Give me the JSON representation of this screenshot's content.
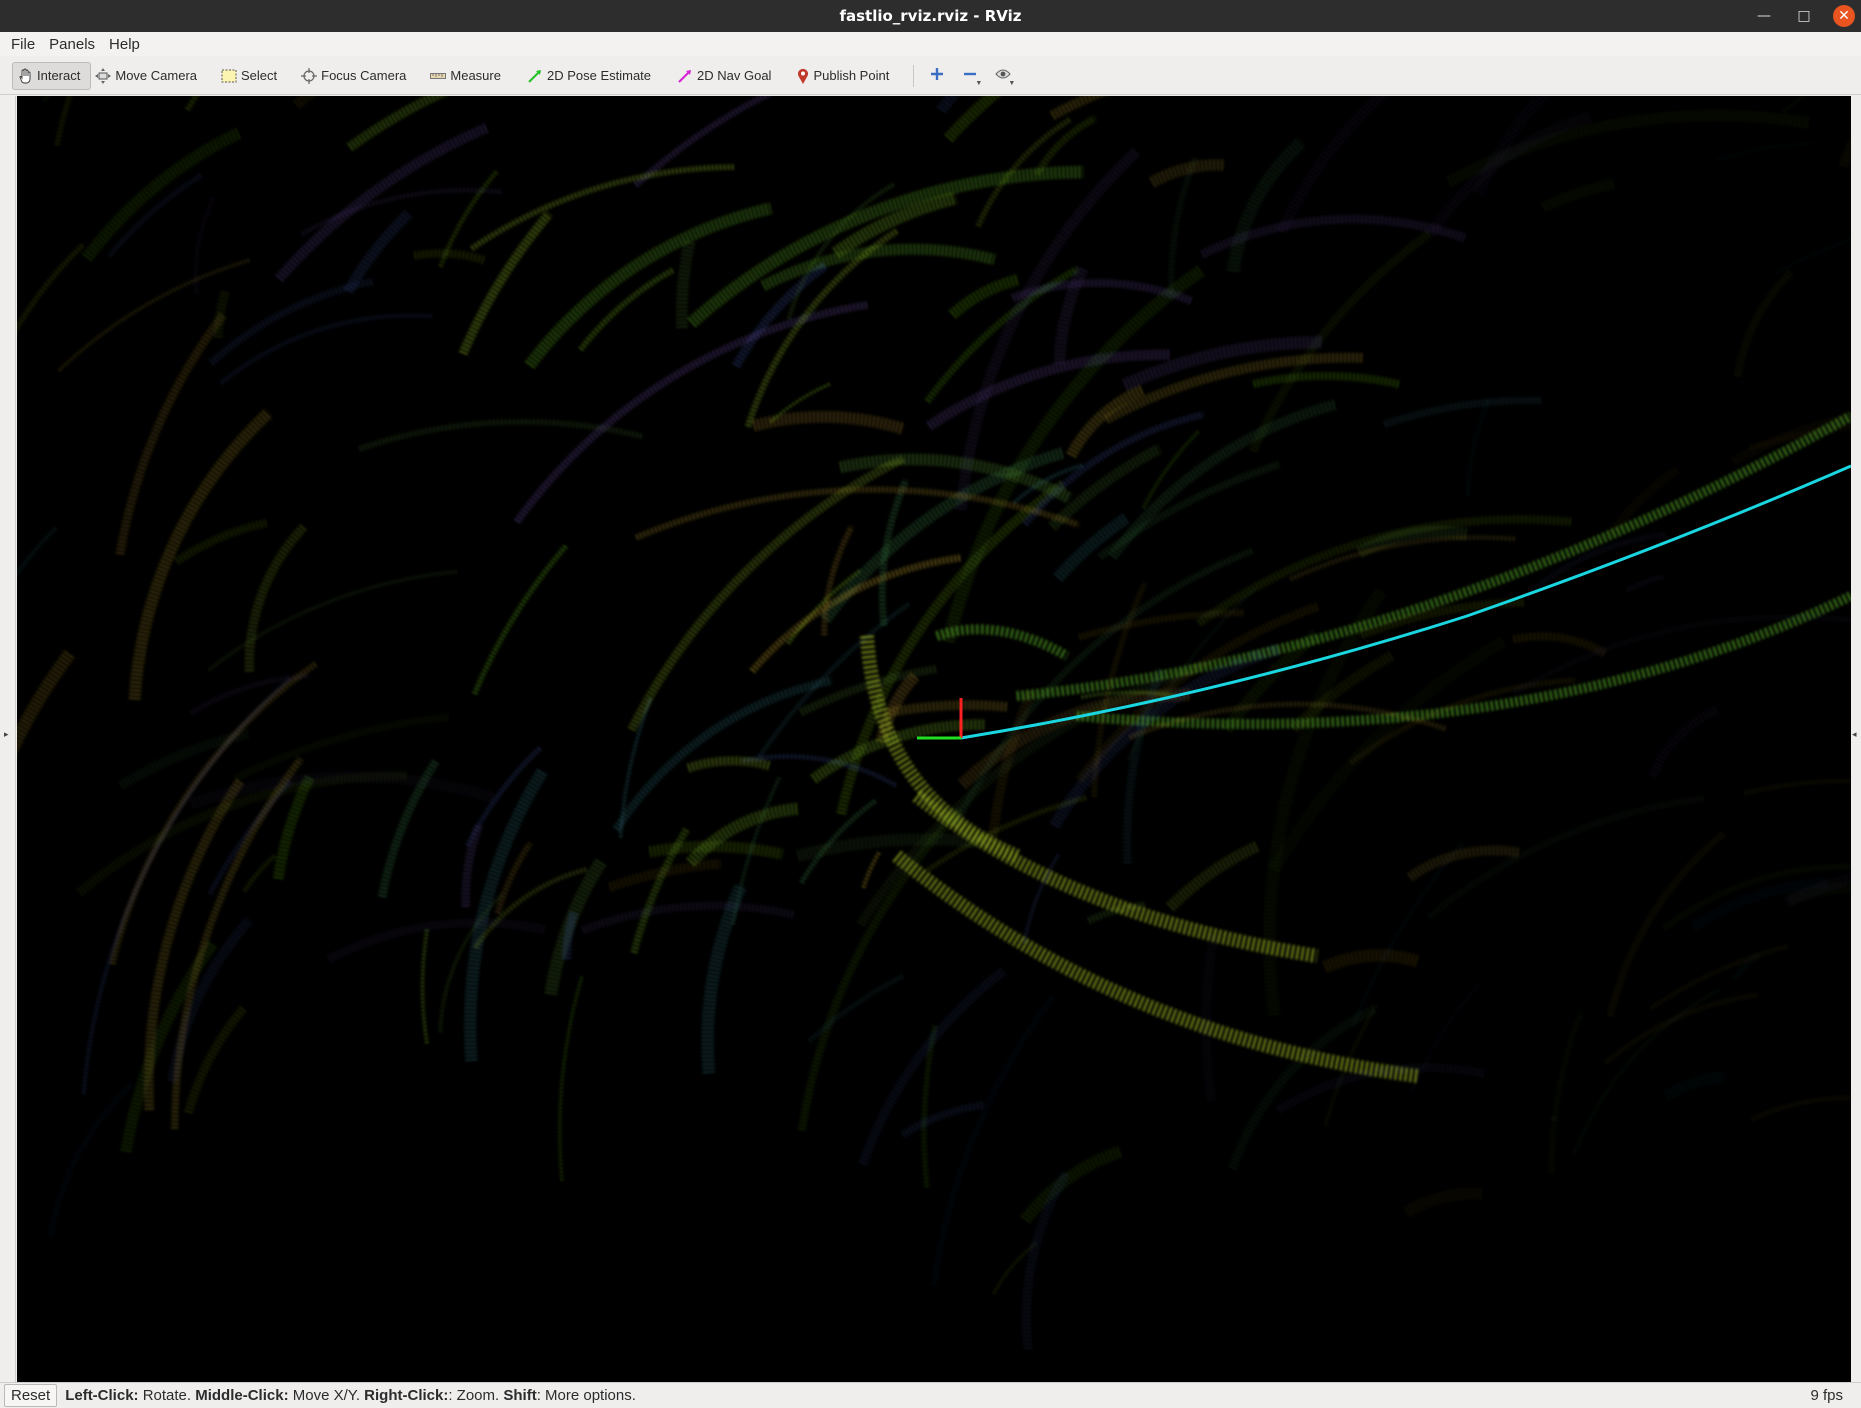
{
  "window": {
    "title": "fastlio_rviz.rviz - RViz",
    "controls": [
      "minimize-icon",
      "maximize-icon",
      "close-icon"
    ]
  },
  "menubar": {
    "items": [
      {
        "label": "File"
      },
      {
        "label": "Panels"
      },
      {
        "label": "Help"
      }
    ]
  },
  "toolbar": {
    "tools": [
      {
        "label": "Interact",
        "icon": "hand-icon",
        "active": true
      },
      {
        "label": "Move Camera",
        "icon": "move-camera-icon",
        "active": false
      },
      {
        "label": "Select",
        "icon": "select-icon",
        "active": false
      },
      {
        "label": "Focus Camera",
        "icon": "focus-camera-icon",
        "active": false
      },
      {
        "label": "Measure",
        "icon": "ruler-icon",
        "active": false
      },
      {
        "label": "2D Pose Estimate",
        "icon": "pose-arrow-icon",
        "active": false
      },
      {
        "label": "2D Nav Goal",
        "icon": "goal-arrow-icon",
        "active": false
      },
      {
        "label": "Publish Point",
        "icon": "map-pin-icon",
        "active": false
      }
    ],
    "extra_icons": [
      "plus-icon",
      "minus-icon",
      "eye-icon"
    ],
    "accent_colors": {
      "pose": "#26c226",
      "goal": "#d622d6",
      "pin": "#c0392b",
      "plus": "#3a6fc4"
    }
  },
  "status": {
    "reset_label": "Reset",
    "hints": [
      {
        "key": "Left-Click:",
        "text": " Rotate. "
      },
      {
        "key": "Middle-Click:",
        "text": " Move X/Y. "
      },
      {
        "key": "Right-Click:",
        "text": ": Zoom. "
      },
      {
        "key": "Shift",
        "text": ": More options."
      }
    ],
    "fps": "9 fps"
  },
  "viewport": {
    "background": "#000000",
    "trajectory_color": "#19d6e0",
    "axis_x_color": "#ff2020",
    "axis_y_color": "#20e020"
  }
}
